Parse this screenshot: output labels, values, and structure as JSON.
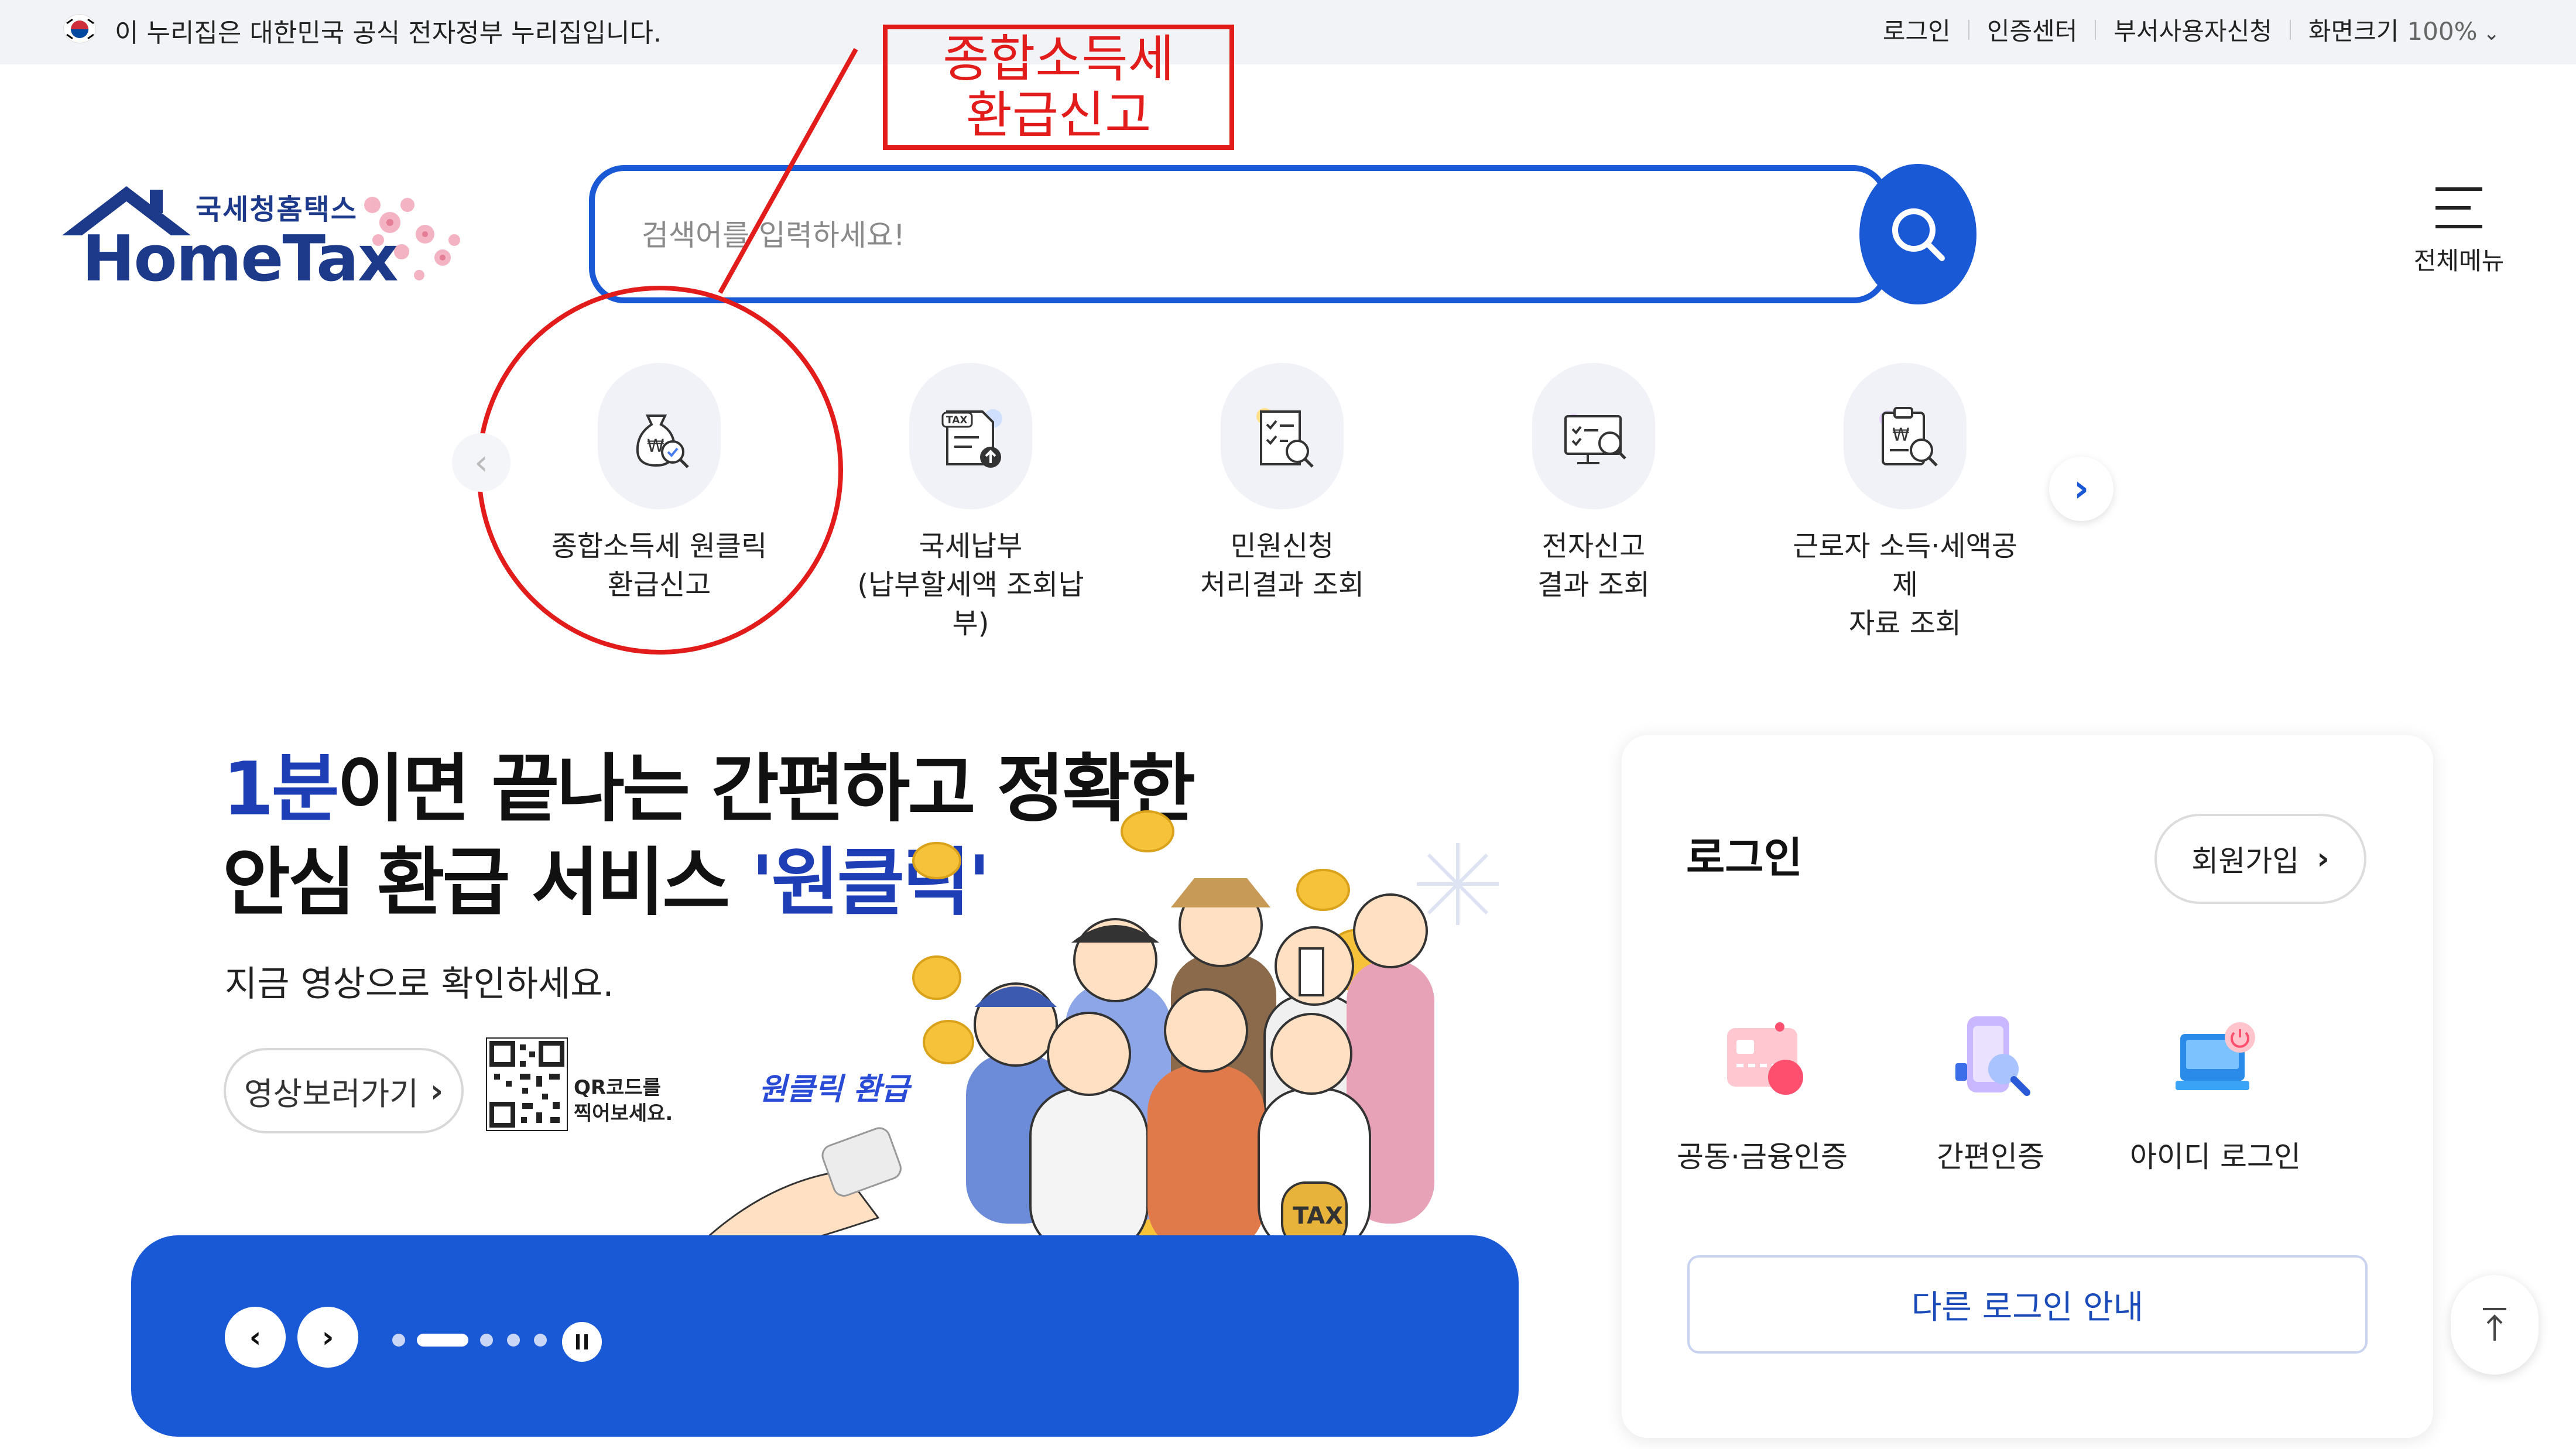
{
  "gov_banner": {
    "text": "이 누리집은 대한민국 공식 전자정부 누리집입니다.",
    "links": {
      "login": "로그인",
      "cert_center": "인증센터",
      "dept_user": "부서사용자신청",
      "zoom_label": "화면크기",
      "zoom_value": "100%"
    }
  },
  "logo": {
    "korean": "국세청홈택스",
    "english": "HomeTax"
  },
  "search": {
    "placeholder": "검색어를 입력하세요!"
  },
  "full_menu": {
    "label": "전체메뉴"
  },
  "annotation": {
    "line1": "종합소득세",
    "line2": "환급신고"
  },
  "quick_services": [
    {
      "label": "종합소득세 원클릭\n환급신고",
      "icon": "money-bag-search-icon"
    },
    {
      "label": "국세납부\n(납부할세액 조회납부)",
      "icon": "tax-document-upload-icon"
    },
    {
      "label": "민원신청\n처리결과 조회",
      "icon": "checklist-search-icon"
    },
    {
      "label": "전자신고\n결과 조회",
      "icon": "monitor-search-icon"
    },
    {
      "label": "근로자 소득·세액공제\n자료 조회",
      "icon": "clipboard-won-search-icon"
    }
  ],
  "banner": {
    "title_highlight": "1분",
    "title_rest1": "이면 끝나는 간편하고 정확한",
    "title_line2_plain": "안심 환급 서비스 ",
    "title_line2_highlight": "'원클릭'",
    "subtitle": "지금 영상으로 확인하세요.",
    "video_button": "영상보러가기",
    "qr_line1": "QR코드를",
    "qr_line2": "찍어보세요.",
    "badge": "원클릭 환급",
    "bag_text": "TAX"
  },
  "login": {
    "title": "로그인",
    "join": "회원가입",
    "methods": [
      "공동·금융인증",
      "간편인증",
      "아이디 로그인"
    ],
    "other": "다른 로그인 안내"
  },
  "colors": {
    "brand_blue": "#1a59d6",
    "annotation_red": "#e21b1b",
    "logo_navy": "#1d3a8a"
  }
}
